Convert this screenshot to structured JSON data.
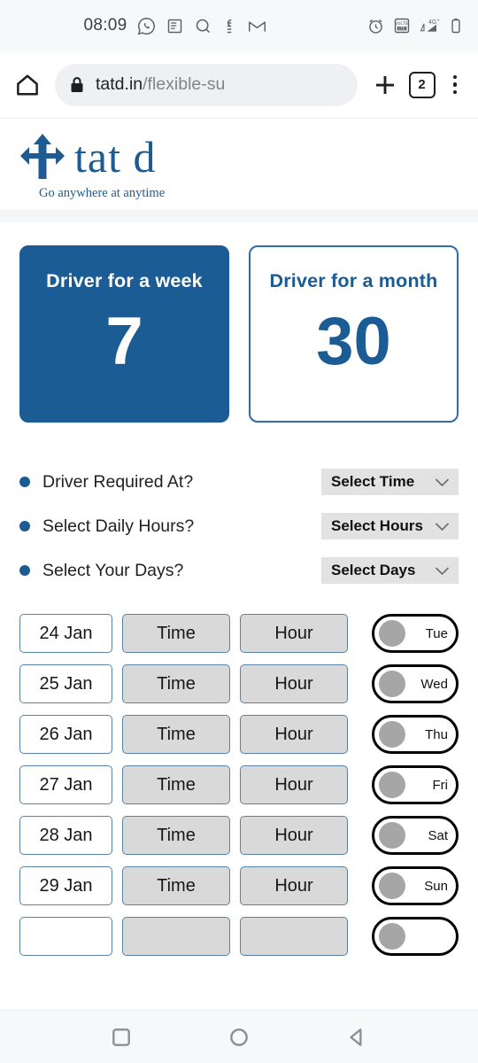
{
  "statusbar": {
    "time": "08:09",
    "left_icons": [
      "whatsapp-icon",
      "news-feed-icon",
      "search-icon",
      "app-icon",
      "gmail-icon"
    ],
    "right_icons": [
      "alarm-icon",
      "volte-icon",
      "signal-4g-plus-icon",
      "battery-icon"
    ],
    "network_label": "4G",
    "volte_top": "VoLTE",
    "volte_bottom": "LTE"
  },
  "browser": {
    "home_icon": "home-icon",
    "lock_icon": "lock-icon",
    "url_domain": "tatd.in",
    "url_path": "/flexible-su",
    "new_tab_icon": "plus-icon",
    "tab_count": "2",
    "menu_icon": "kebab-menu-icon"
  },
  "site": {
    "logo_icon": "three-way-arrow-logo",
    "brand": "tat d",
    "tagline": "Go anywhere at anytime"
  },
  "plans": [
    {
      "title": "Driver for a week",
      "number": "7",
      "active": true
    },
    {
      "title": "Driver for a month",
      "number": "30",
      "active": false
    }
  ],
  "questions": [
    {
      "label": "Driver Required At?",
      "value": "Select Time",
      "icon": "chevron-down-icon"
    },
    {
      "label": "Select Daily Hours?",
      "value": "Select Hours",
      "icon": "chevron-down-icon"
    },
    {
      "label": "Select Your Days?",
      "value": "Select Days",
      "icon": "chevron-down-icon"
    }
  ],
  "schedule": {
    "time_placeholder": "Time",
    "hour_placeholder": "Hour",
    "rows": [
      {
        "date": "24 Jan",
        "time": "Time",
        "hour": "Hour",
        "day": "Tue",
        "enabled": false
      },
      {
        "date": "25 Jan",
        "time": "Time",
        "hour": "Hour",
        "day": "Wed",
        "enabled": false
      },
      {
        "date": "26 Jan",
        "time": "Time",
        "hour": "Hour",
        "day": "Thu",
        "enabled": false
      },
      {
        "date": "27 Jan",
        "time": "Time",
        "hour": "Hour",
        "day": "Fri",
        "enabled": false
      },
      {
        "date": "28 Jan",
        "time": "Time",
        "hour": "Hour",
        "day": "Sat",
        "enabled": false
      },
      {
        "date": "29 Jan",
        "time": "Time",
        "hour": "Hour",
        "day": "Sun",
        "enabled": false
      }
    ]
  },
  "navbar": {
    "recents_icon": "square-recents-icon",
    "home_icon": "circle-home-icon",
    "back_icon": "triangle-back-icon"
  },
  "colors": {
    "brand_blue": "#1b5c94",
    "box_border": "#5a82a6",
    "slot_grey": "#d9d9d9",
    "select_grey": "#e2e2e2"
  }
}
